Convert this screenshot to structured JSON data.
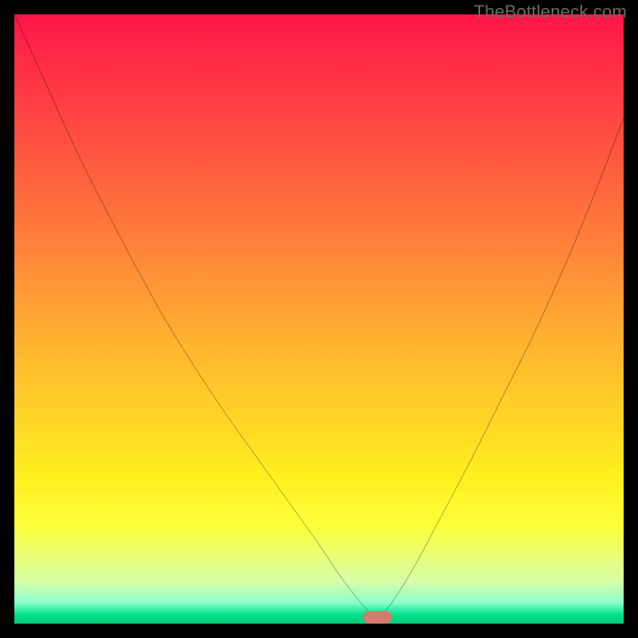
{
  "watermark": "TheBottleneck.com",
  "chart_data": {
    "type": "line",
    "title": "",
    "subtitle": "",
    "xlabel": "",
    "ylabel": "",
    "xlim": [
      0,
      100
    ],
    "ylim": [
      0,
      100
    ],
    "grid": false,
    "legend": false,
    "x": [
      0,
      5,
      10,
      15,
      20,
      25,
      30,
      35,
      40,
      45,
      50,
      53,
      56,
      58,
      59.5,
      61,
      63,
      66,
      70,
      75,
      80,
      85,
      90,
      95,
      100
    ],
    "y": [
      100,
      89,
      78,
      68,
      58.5,
      49.5,
      41.5,
      34,
      27,
      20,
      13,
      8.5,
      4.5,
      2.2,
      1.0,
      2.2,
      5.0,
      10,
      17.5,
      27,
      37,
      47,
      58,
      70,
      83
    ],
    "marker": {
      "x": 59.5,
      "y": 1.0,
      "color": "#d77a6f"
    },
    "background_gradient": {
      "top": "#ff1448",
      "mid": "#ffd326",
      "bottom": "#00c877"
    }
  }
}
